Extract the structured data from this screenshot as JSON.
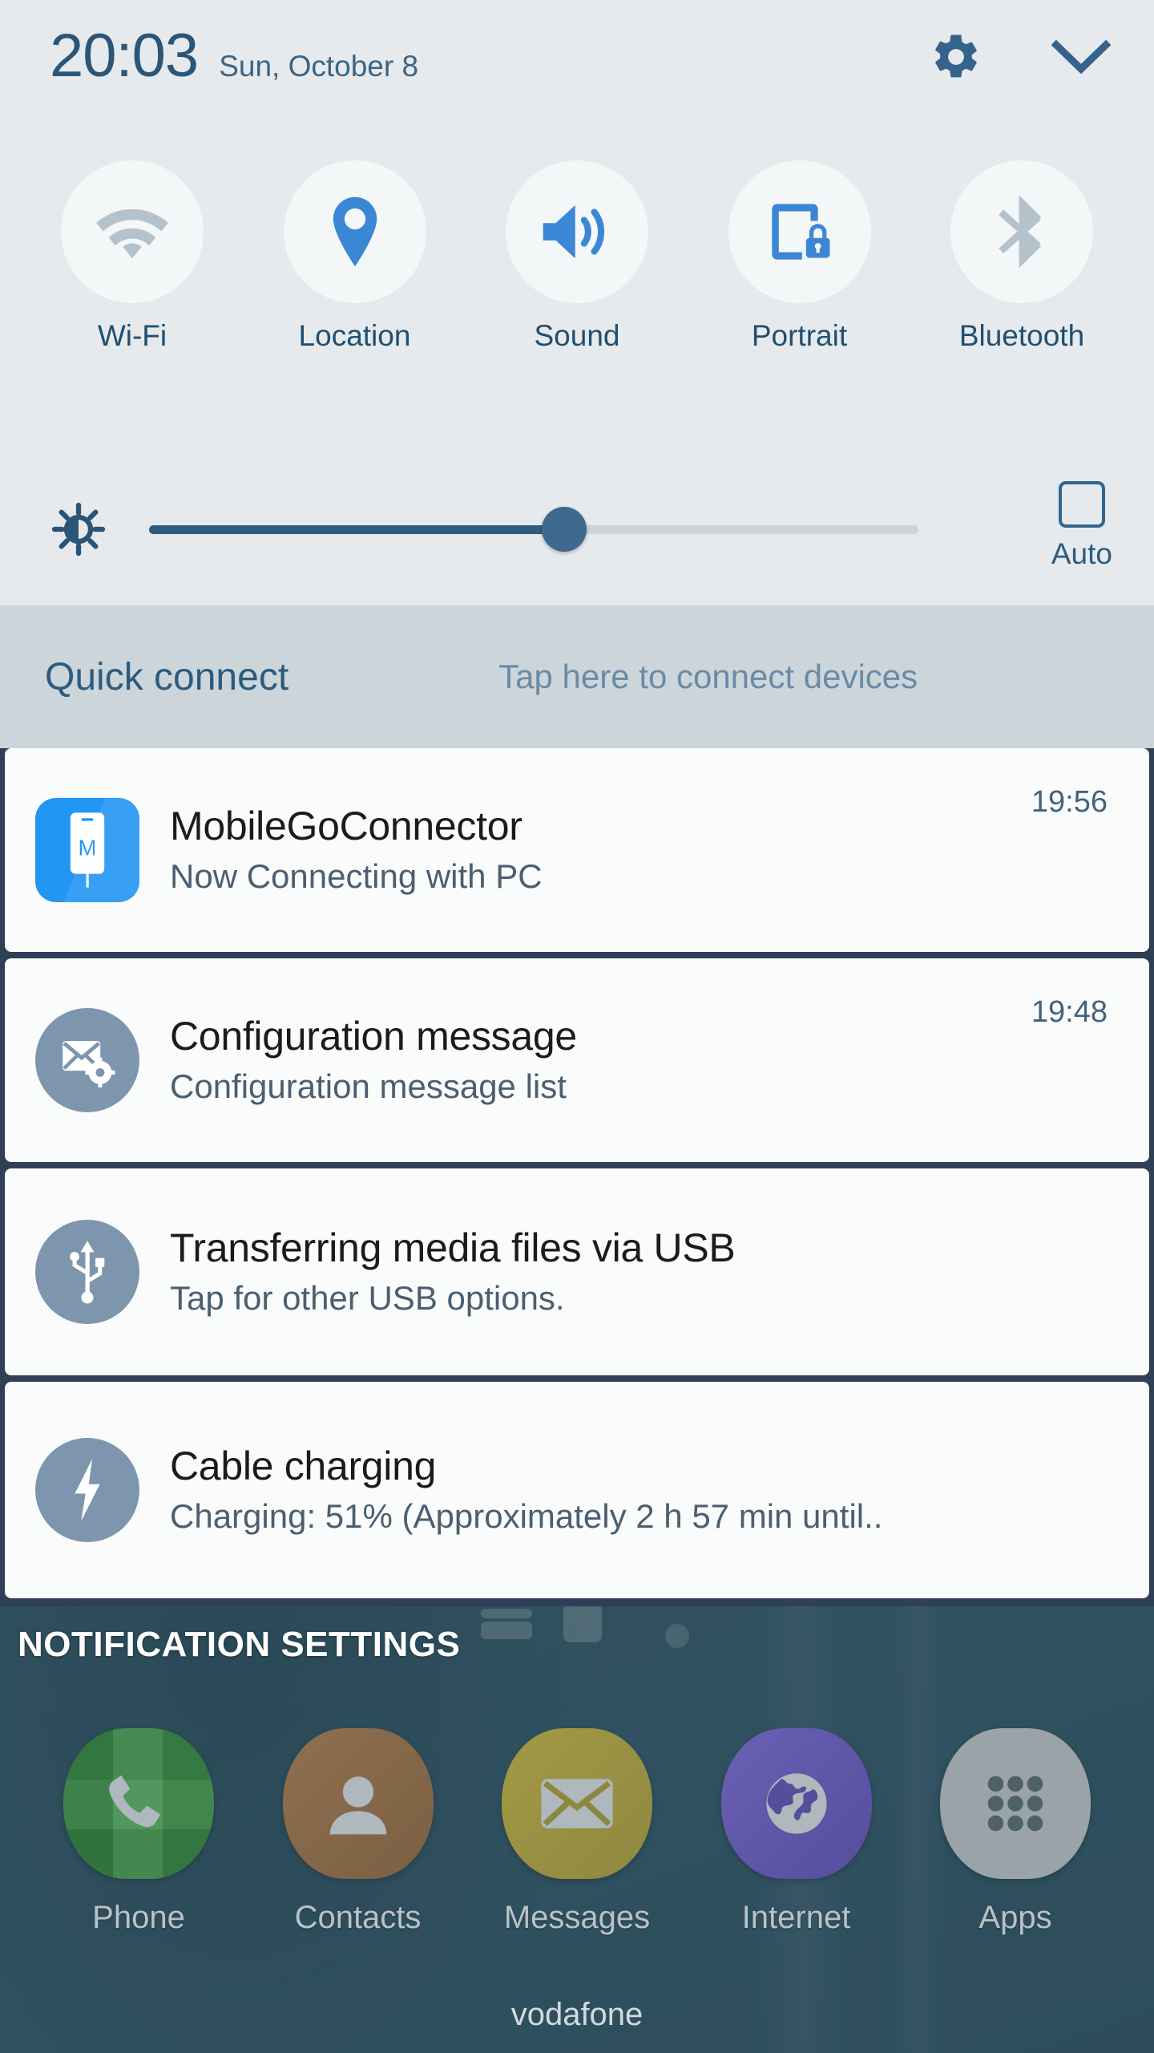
{
  "statusbar": {
    "time": "20:03",
    "date": "Sun, October 8",
    "settings_icon": "gear-icon",
    "collapse_icon": "chevron-down-icon"
  },
  "quick_toggles": [
    {
      "label": "Wi-Fi",
      "icon": "wifi-icon",
      "state": "off",
      "color": "#b4c2cc"
    },
    {
      "label": "Location",
      "icon": "location-pin-icon",
      "state": "on",
      "color": "#3b87d6"
    },
    {
      "label": "Sound",
      "icon": "speaker-icon",
      "state": "on",
      "color": "#3b87d6"
    },
    {
      "label": "Portrait",
      "icon": "rotation-lock-icon",
      "state": "on",
      "color": "#3b87d6"
    },
    {
      "label": "Bluetooth",
      "icon": "bluetooth-icon",
      "state": "off",
      "color": "#b4c2cc"
    }
  ],
  "brightness": {
    "icon": "brightness-icon",
    "value_percent": 54,
    "auto_label": "Auto",
    "auto_checked": false
  },
  "quick_connect": {
    "title": "Quick connect",
    "hint": "Tap here to connect devices"
  },
  "notifications": [
    {
      "title": "MobileGoConnector",
      "text": "Now Connecting with PC",
      "time": "19:56",
      "icon": "mobilego-phone-icon",
      "icon_style": "square",
      "icon_bg": "#2196f3"
    },
    {
      "title": "Configuration message",
      "text": "Configuration message list",
      "time": "19:48",
      "icon": "envelope-gear-icon",
      "icon_style": "circle",
      "icon_bg": "#7d96ad"
    },
    {
      "title": "Transferring media files via USB",
      "text": "Tap for other USB options.",
      "time": "",
      "icon": "usb-icon",
      "icon_style": "circle",
      "icon_bg": "#7d96ad"
    },
    {
      "title": "Cable charging",
      "text": "Charging: 51% (Approximately 2 h 57 min until..",
      "time": "",
      "icon": "lightning-bolt-icon",
      "icon_style": "circle",
      "icon_bg": "#7d96ad"
    }
  ],
  "notification_settings": {
    "label": "NOTIFICATION SETTINGS"
  },
  "dock": [
    {
      "label": "Phone",
      "icon": "phone-handset-icon",
      "bg": "#3d8b4a"
    },
    {
      "label": "Contacts",
      "icon": "person-icon",
      "bg": "#8a6a48"
    },
    {
      "label": "Messages",
      "icon": "envelope-icon",
      "bg": "#9a9242"
    },
    {
      "label": "Internet",
      "icon": "globe-icon",
      "bg": "#5d54a8"
    },
    {
      "label": "Apps",
      "icon": "app-grid-icon",
      "bg": "#9aa4a8"
    }
  ],
  "carrier": {
    "name": "vodafone"
  },
  "colors": {
    "panel_bg": "#e6eaec",
    "quick_connect_bg": "#ccd6da",
    "notification_gutter": "#2e3f56",
    "accent_blue": "#3b87d6",
    "text_dark_blue": "#1f4f71"
  }
}
